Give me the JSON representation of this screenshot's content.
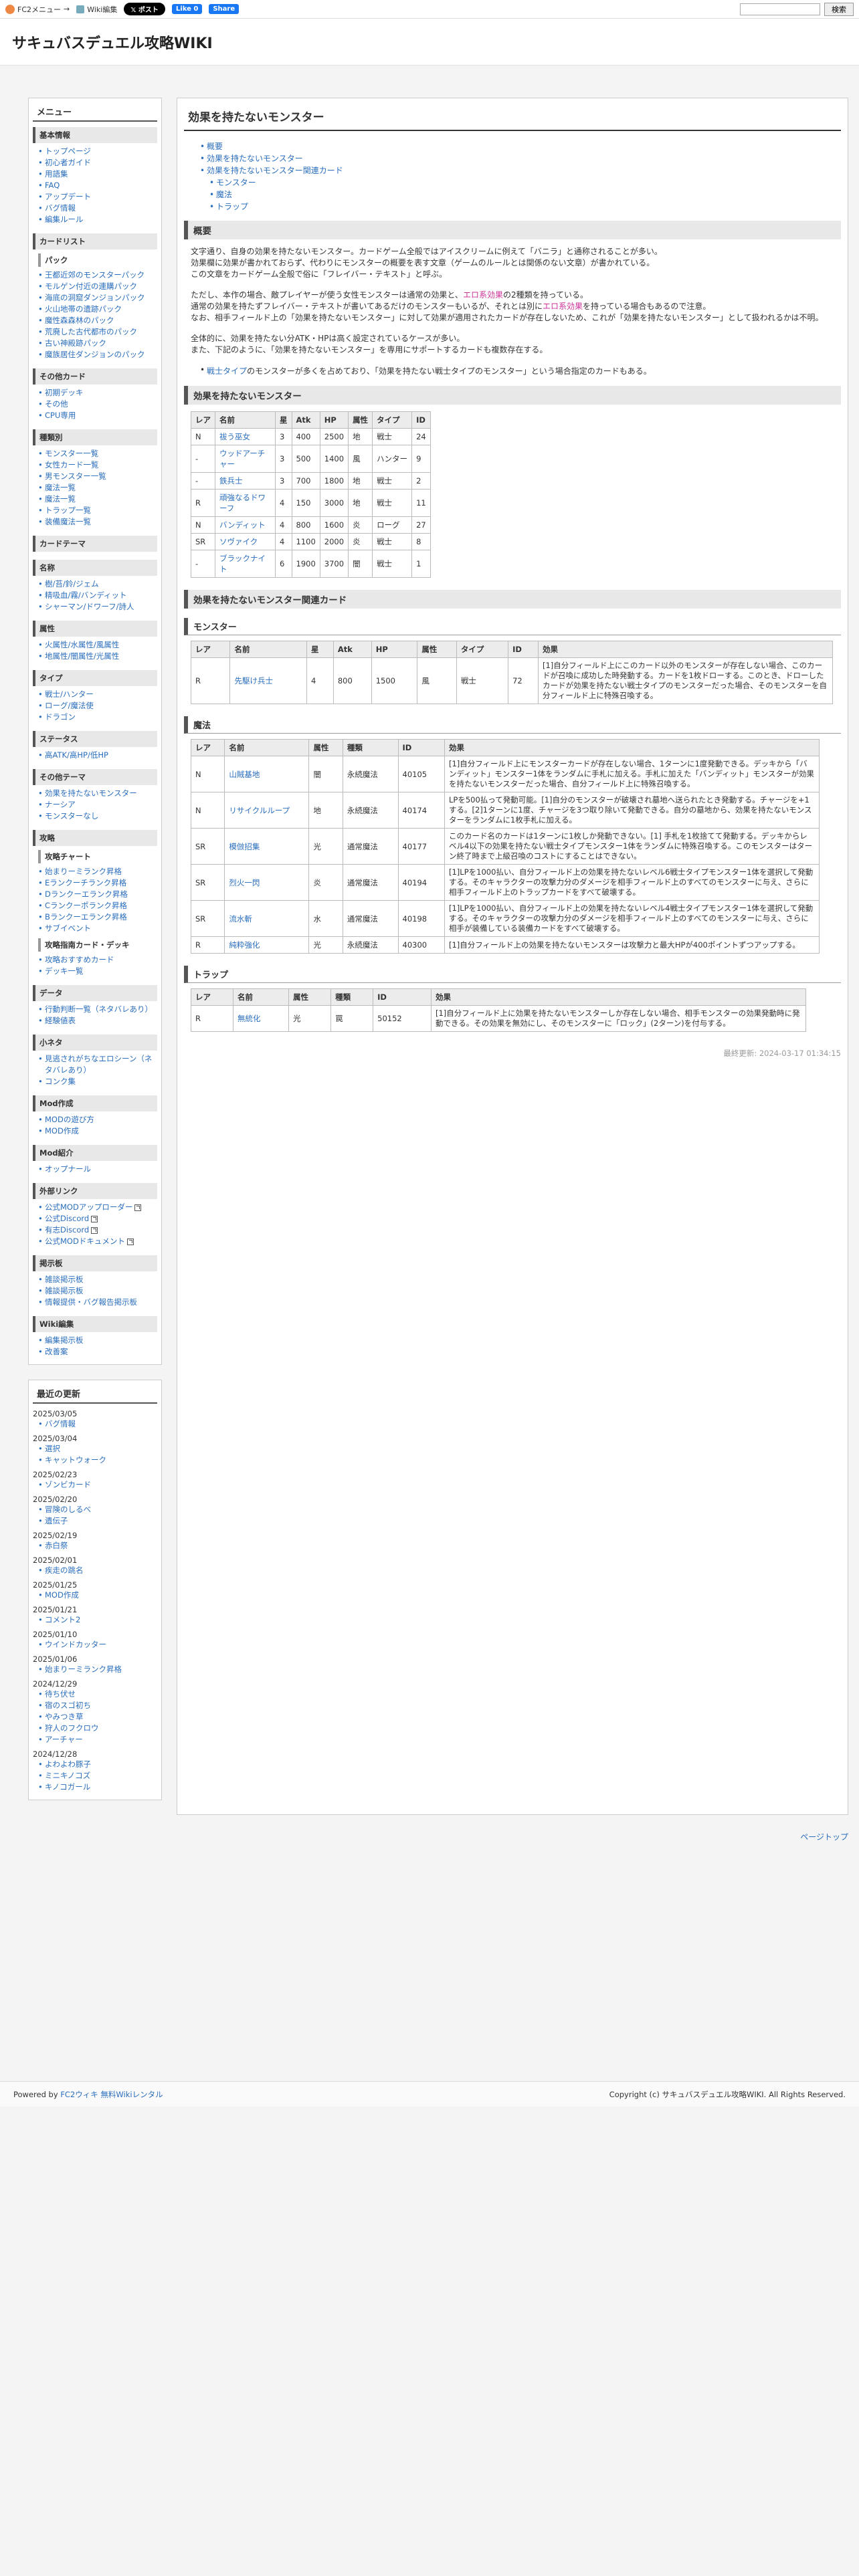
{
  "topbar": {
    "fc2_menu": "FC2メニュー",
    "wiki_edit": "Wiki編集",
    "x_post": "𝕏 ポスト",
    "fb_like": "Like 0",
    "fb_share": "Share",
    "search_button": "検索"
  },
  "site_title": "サキュバスデュエル攻略WIKI",
  "menu": {
    "title": "メニュー",
    "sections": [
      {
        "title": "基本情報",
        "items": [
          "トップページ",
          "初心者ガイド",
          "用語集",
          "FAQ",
          "アップデート",
          "バグ情報",
          "編集ルール"
        ]
      },
      {
        "title": "カードリスト",
        "items": []
      },
      {
        "title": "パック",
        "items": [
          "王都近郊のモンスターパック",
          "モルゲン付近の連購パック",
          "海底の洞窟ダンジョンパック",
          "火山地帯の遺跡パック",
          "魔性森森林のパック",
          "荒廃した古代都市のパック",
          "古い神殿跡パック",
          "魔族居住ダンジョンのパック"
        ]
      },
      {
        "title": "その他カード",
        "items": [
          "初期デッキ",
          "その他",
          "CPU専用"
        ]
      },
      {
        "title": "種類別",
        "items": [
          "モンスター一覧",
          "女性カード一覧",
          "男モンスター一覧",
          "魔法一覧",
          "魔法一覧",
          "トラップ一覧",
          "装備魔法一覧"
        ]
      },
      {
        "title": "カードテーマ",
        "items": []
      },
      {
        "title": "名称",
        "items": [
          "樹/苔/鈴/ジェム",
          "精吸血/霧/バンディット",
          "シャーマン/ドワーフ/詩人"
        ]
      },
      {
        "title": "属性",
        "items": [
          "火属性/水属性/風属性",
          "地属性/闇属性/光属性"
        ]
      },
      {
        "title": "タイプ",
        "items": [
          "戦士/ハンター",
          "ローグ/魔法使",
          "ドラゴン"
        ]
      },
      {
        "title": "ステータス",
        "items": [
          "高ATK/高HP/低HP"
        ]
      },
      {
        "title": "その他テーマ",
        "items": [
          "効果を持たないモンスター",
          "ナーシア",
          "モンスターなし"
        ]
      },
      {
        "title": "攻略",
        "items": []
      },
      {
        "title": "攻略チャート",
        "items": [
          "始まりーミランク昇格",
          "Eランクーチランク昇格",
          "Dランクーエランク昇格",
          "Cランクーポランク昇格",
          "Bランクーエランク昇格",
          "サブイベント"
        ]
      },
      {
        "title": "攻略指南カード・デッキ",
        "items": [
          "攻略おすすめカード",
          "デッキ一覧"
        ]
      },
      {
        "title": "データ",
        "items": [
          "行動判断一覧（ネタバレあり）",
          "経験値表"
        ]
      },
      {
        "title": "小ネタ",
        "items": [
          "見逃されがちなエロシーン（ネタバレあり）",
          "コンク集"
        ]
      },
      {
        "title": "Mod作成",
        "items": [
          "MODの遊び方",
          "MOD作成"
        ]
      },
      {
        "title": "Mod紹介",
        "items": [
          "オップナール"
        ]
      },
      {
        "title": "外部リンク",
        "items": [
          "公式MODアップローダー",
          "公式Discord",
          "有志Discord",
          "公式MODドキュメント"
        ]
      },
      {
        "title": "掲示板",
        "items": [
          "雑談掲示板",
          "雑談掲示板",
          "情報提供・バグ報告掲示板"
        ]
      },
      {
        "title": "Wiki編集",
        "items": [
          "編集掲示板",
          "改善案"
        ]
      }
    ]
  },
  "recent": {
    "title": "最近の更新",
    "entries": [
      {
        "date": "2025/03/05",
        "items": [
          "バグ情報"
        ]
      },
      {
        "date": "2025/03/04",
        "items": [
          "選択",
          "キャットウォーク"
        ]
      },
      {
        "date": "2025/02/23",
        "items": [
          "ゾンビカード"
        ]
      },
      {
        "date": "2025/02/20",
        "items": [
          "冒険のしるべ",
          "遺伝子"
        ]
      },
      {
        "date": "2025/02/19",
        "items": [
          "赤白祭"
        ]
      },
      {
        "date": "2025/02/01",
        "items": [
          "疾走の跳名"
        ]
      },
      {
        "date": "2025/01/25",
        "items": [
          "MOD作成"
        ]
      },
      {
        "date": "2025/01/21",
        "items": [
          "コメント2"
        ]
      },
      {
        "date": "2025/01/10",
        "items": [
          "ウインドカッター"
        ]
      },
      {
        "date": "2025/01/06",
        "items": [
          "始まりーミランク昇格"
        ]
      },
      {
        "date": "2024/12/29",
        "items": [
          "待ち伏せ",
          "宿のスゴ初ち",
          "やみつき草",
          "狩人のフクロウ",
          "アーチャー"
        ]
      },
      {
        "date": "2024/12/28",
        "items": [
          "よわよわ豚子",
          "ミニキノコズ",
          "キノコガール"
        ]
      }
    ]
  },
  "main": {
    "title": "効果を持たないモンスター",
    "toc": [
      {
        "label": "概要",
        "sub": false
      },
      {
        "label": "効果を持たないモンスター",
        "sub": false
      },
      {
        "label": "効果を持たないモンスター関連カード",
        "sub": false
      },
      {
        "label": "モンスター",
        "sub": true
      },
      {
        "label": "魔法",
        "sub": true
      },
      {
        "label": "トラップ",
        "sub": true
      }
    ],
    "overview_h": "概要",
    "overview_p1": [
      "文字通り、自身の効果を持たないモンスター。カードゲーム全般ではアイスクリームに例えて「バニラ」と通称されることが多い。",
      "効果欄に効果が書かれておらず、代わりにモンスターの概要を表す文章（ゲームのルールとは関係のない文章）が書かれている。",
      "この文章をカードゲーム全般で俗に「フレイバー・テキスト」と呼ぶ。"
    ],
    "overview_p2_pre": "ただし、本作の場合、敵プレイヤーが使う女性モンスターは通常の効果と、",
    "overview_p2_pink1": "エロ系効果",
    "overview_p2_mid": "の2種類を持っている。",
    "overview_p2_b": "通常の効果を持たずフレイバー・テキストが書いてあるだけのモンスターもいるが、それとは別に",
    "overview_p2_pink2": "エロ系効果",
    "overview_p2_c": "を持っている場合もあるので注意。",
    "overview_p2_d": "なお、相手フィールド上の「効果を持たないモンスター」に対して効果が適用されたカードが存在しないため、これが「効果を持たないモンスター」として扱われるかは不明。",
    "overview_p3": [
      "全体的に、効果を持たない分ATK・HPは高く設定されているケースが多い。",
      "また、下記のように、「効果を持たないモンスター」を専用にサポートするカードも複数存在する。"
    ],
    "overview_bullet_link": "戦士タイプ",
    "overview_bullet_rest": "のモンスターが多くを占めており、「効果を持たない戦士タイプのモンスター」という場合指定のカードもある。",
    "monsters_h": "効果を持たないモンスター",
    "monster_headers": [
      "レア",
      "名前",
      "星",
      "Atk",
      "HP",
      "属性",
      "タイプ",
      "ID"
    ],
    "monsters": [
      [
        "N",
        "祓う巫女",
        "3",
        "400",
        "2500",
        "地",
        "戦士",
        "24"
      ],
      [
        "-",
        "ウッドアーチャー",
        "3",
        "500",
        "1400",
        "風",
        "ハンター",
        "9"
      ],
      [
        "-",
        "鉄兵士",
        "3",
        "700",
        "1800",
        "地",
        "戦士",
        "2"
      ],
      [
        "R",
        "頑強なるドワーフ",
        "4",
        "150",
        "3000",
        "地",
        "戦士",
        "11"
      ],
      [
        "N",
        "バンディット",
        "4",
        "800",
        "1600",
        "炎",
        "ローグ",
        "27"
      ],
      [
        "SR",
        "ソヴァイク",
        "4",
        "1100",
        "2000",
        "炎",
        "戦士",
        "8"
      ],
      [
        "-",
        "ブラックナイト",
        "6",
        "1900",
        "3700",
        "闇",
        "戦士",
        "1"
      ]
    ],
    "related_h": "効果を持たないモンスター関連カード",
    "rel_monster_h": "モンスター",
    "rel_monster_headers": [
      "レア",
      "名前",
      "星",
      "Atk",
      "HP",
      "属性",
      "タイプ",
      "ID",
      "効果"
    ],
    "rel_monsters": [
      [
        "R",
        "先駆け兵士",
        "4",
        "800",
        "1500",
        "風",
        "戦士",
        "72",
        "[1]自分フィールド上にこのカード以外のモンスターが存在しない場合、このカードが召喚に成功した時発動する。カードを1枚ドローする。このとき、ドローしたカードが効果を持たない戦士タイプのモンスターだった場合、そのモンスターを自分フィールド上に特殊召喚する。"
      ]
    ],
    "rel_magic_h": "魔法",
    "rel_magic_headers": [
      "レア",
      "名前",
      "属性",
      "種類",
      "ID",
      "効果"
    ],
    "rel_magic": [
      [
        "N",
        "山賊基地",
        "闇",
        "永続魔法",
        "40105",
        "[1]自分フィールド上にモンスターカードが存在しない場合、1ターンに1度発動できる。デッキから「バンディット」モンスター1体をランダムに手札に加える。手札に加えた「バンディット」モンスターが効果を持たないモンスターだった場合、自分フィールド上に特殊召喚する。"
      ],
      [
        "N",
        "リサイクルループ",
        "地",
        "永続魔法",
        "40174",
        "LPを500払って発動可能。[1]自分のモンスターが破壊され墓地へ送られたとき発動する。チャージを+1する。[2]1ターンに1度、チャージを3つ取り除いて発動できる。自分の墓地から、効果を持たないモンスターをランダムに1枚手札に加える。"
      ],
      [
        "SR",
        "模倣招集",
        "光",
        "通常魔法",
        "40177",
        "このカード名のカードは1ターンに1枚しか発動できない。[1] 手札を1枚捨てて発動する。デッキからレベル4以下の効果を持たない戦士タイプモンスター1体をランダムに特殊召喚する。このモンスターはターン終了時まで上級召喚のコストにすることはできない。"
      ],
      [
        "SR",
        "烈火一閃",
        "炎",
        "通常魔法",
        "40194",
        "[1]LPを1000払い、自分フィールド上の効果を持たないレベル6戦士タイプモンスター1体を選択して発動する。そのキャラクターの攻撃力分のダメージを相手フィールド上のすべてのモンスターに与え、さらに相手フィールド上のトラップカードをすべて破壊する。"
      ],
      [
        "SR",
        "流水斬",
        "水",
        "通常魔法",
        "40198",
        "[1]LPを1000払い、自分フィールド上の効果を持たないレベル4戦士タイプモンスター1体を選択して発動する。そのキャラクターの攻撃力分のダメージを相手フィールド上のすべてのモンスターに与え、さらに相手が装備している装備カードをすべて破壊する。"
      ],
      [
        "R",
        "純粋強化",
        "光",
        "永続魔法",
        "40300",
        "[1]自分フィールド上の効果を持たないモンスターは攻撃力と最大HPが400ポイントずつアップする。"
      ]
    ],
    "rel_trap_h": "トラップ",
    "rel_trap_headers": [
      "レア",
      "名前",
      "属性",
      "種類",
      "ID",
      "効果"
    ],
    "rel_traps": [
      [
        "R",
        "無統化",
        "光",
        "罠",
        "50152",
        "[1]自分フィールド上に効果を持たないモンスターしか存在しない場合、相手モンスターの効果発動時に発動できる。その効果を無効にし、そのモンスターに「ロック」(2ターン)を付与する。"
      ]
    ],
    "last_updated": "最終更新: 2024-03-17 01:34:15"
  },
  "pagetop": "ページトップ",
  "footer": {
    "left_pre": "Powered by ",
    "left_link1": "FC2ウィキ",
    "left_link2": "無料Wikiレンタル",
    "right": "Copyright (c) サキュバスデュエル攻略WIKI. All Rights Reserved."
  }
}
